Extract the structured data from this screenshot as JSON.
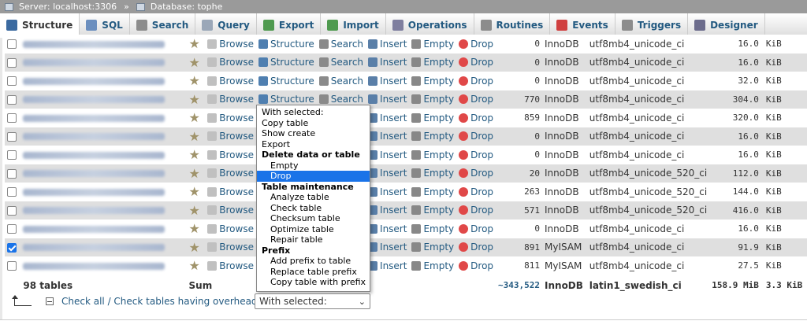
{
  "breadcrumb": {
    "server": "Server: localhost:3306",
    "separator": "»",
    "database": "Database: tophe"
  },
  "tabs": [
    {
      "label": "Structure",
      "icon": "structure-icon",
      "color": "#3b6aa0"
    },
    {
      "label": "SQL",
      "icon": "sql-icon",
      "color": "#6c8fbf"
    },
    {
      "label": "Search",
      "icon": "search-icon",
      "color": "#8c8c8c"
    },
    {
      "label": "Query",
      "icon": "query-icon",
      "color": "#9aa7b8"
    },
    {
      "label": "Export",
      "icon": "export-icon",
      "color": "#4f9a4f"
    },
    {
      "label": "Import",
      "icon": "import-icon",
      "color": "#4f9a4f"
    },
    {
      "label": "Operations",
      "icon": "wrench-icon",
      "color": "#7f7f9f"
    },
    {
      "label": "Routines",
      "icon": "routines-icon",
      "color": "#8c8c8c"
    },
    {
      "label": "Events",
      "icon": "clock-icon",
      "color": "#d04040"
    },
    {
      "label": "Triggers",
      "icon": "triggers-icon",
      "color": "#8c8c8c"
    },
    {
      "label": "Designer",
      "icon": "designer-icon",
      "color": "#6c6c8c"
    }
  ],
  "actions": {
    "browse": "Browse",
    "structure": "Structure",
    "search": "Search",
    "insert": "Insert",
    "empty": "Empty",
    "drop": "Drop"
  },
  "rows": [
    {
      "rows": "0",
      "engine": "InnoDB",
      "collation": "utf8mb4_unicode_ci",
      "size": "16.0",
      "unit": "KiB",
      "checked": false
    },
    {
      "rows": "0",
      "engine": "InnoDB",
      "collation": "utf8mb4_unicode_ci",
      "size": "16.0",
      "unit": "KiB",
      "checked": false
    },
    {
      "rows": "0",
      "engine": "InnoDB",
      "collation": "utf8mb4_unicode_ci",
      "size": "32.0",
      "unit": "KiB",
      "checked": false
    },
    {
      "rows": "770",
      "engine": "InnoDB",
      "collation": "utf8mb4_unicode_ci",
      "size": "304.0",
      "unit": "KiB",
      "checked": false
    },
    {
      "rows": "859",
      "engine": "InnoDB",
      "collation": "utf8mb4_unicode_ci",
      "size": "320.0",
      "unit": "KiB",
      "checked": false
    },
    {
      "rows": "0",
      "engine": "InnoDB",
      "collation": "utf8mb4_unicode_ci",
      "size": "16.0",
      "unit": "KiB",
      "checked": false
    },
    {
      "rows": "0",
      "engine": "InnoDB",
      "collation": "utf8mb4_unicode_ci",
      "size": "16.0",
      "unit": "KiB",
      "checked": false
    },
    {
      "rows": "20",
      "engine": "InnoDB",
      "collation": "utf8mb4_unicode_520_ci",
      "size": "112.0",
      "unit": "KiB",
      "checked": false
    },
    {
      "rows": "263",
      "engine": "InnoDB",
      "collation": "utf8mb4_unicode_520_ci",
      "size": "144.0",
      "unit": "KiB",
      "checked": false
    },
    {
      "rows": "571",
      "engine": "InnoDB",
      "collation": "utf8mb4_unicode_520_ci",
      "size": "416.0",
      "unit": "KiB",
      "checked": false
    },
    {
      "rows": "0",
      "engine": "InnoDB",
      "collation": "utf8mb4_unicode_ci",
      "size": "16.0",
      "unit": "KiB",
      "checked": false
    },
    {
      "rows": "891",
      "engine": "MyISAM",
      "collation": "utf8mb4_unicode_ci",
      "size": "91.9",
      "unit": "KiB",
      "checked": true
    },
    {
      "rows": "811",
      "engine": "MyISAM",
      "collation": "utf8mb4_unicode_ci",
      "size": "27.5",
      "unit": "KiB",
      "checked": false
    }
  ],
  "summary": {
    "tables": "98 tables",
    "sum": "Sum",
    "rows": "~343,522",
    "engine": "InnoDB",
    "collation": "latin1_swedish_ci",
    "size": "158.9 MiB",
    "overhead": "3.3 KiB"
  },
  "menu": {
    "items": [
      {
        "label": "With selected:",
        "type": "item"
      },
      {
        "label": "Copy table",
        "type": "item"
      },
      {
        "label": "Show create",
        "type": "item"
      },
      {
        "label": "Export",
        "type": "item"
      },
      {
        "label": "Delete data or table",
        "type": "group"
      },
      {
        "label": "Empty",
        "type": "sub"
      },
      {
        "label": "Drop",
        "type": "sub",
        "selected": true
      },
      {
        "label": "Table maintenance",
        "type": "group"
      },
      {
        "label": "Analyze table",
        "type": "sub"
      },
      {
        "label": "Check table",
        "type": "sub"
      },
      {
        "label": "Checksum table",
        "type": "sub"
      },
      {
        "label": "Optimize table",
        "type": "sub"
      },
      {
        "label": "Repair table",
        "type": "sub"
      },
      {
        "label": "Prefix",
        "type": "group"
      },
      {
        "label": "Add prefix to table",
        "type": "sub"
      },
      {
        "label": "Replace table prefix",
        "type": "sub"
      },
      {
        "label": "Copy table with prefix",
        "type": "sub"
      }
    ]
  },
  "footer": {
    "check_all": "Check all / Check tables having overhead",
    "select_value": "With selected:"
  }
}
